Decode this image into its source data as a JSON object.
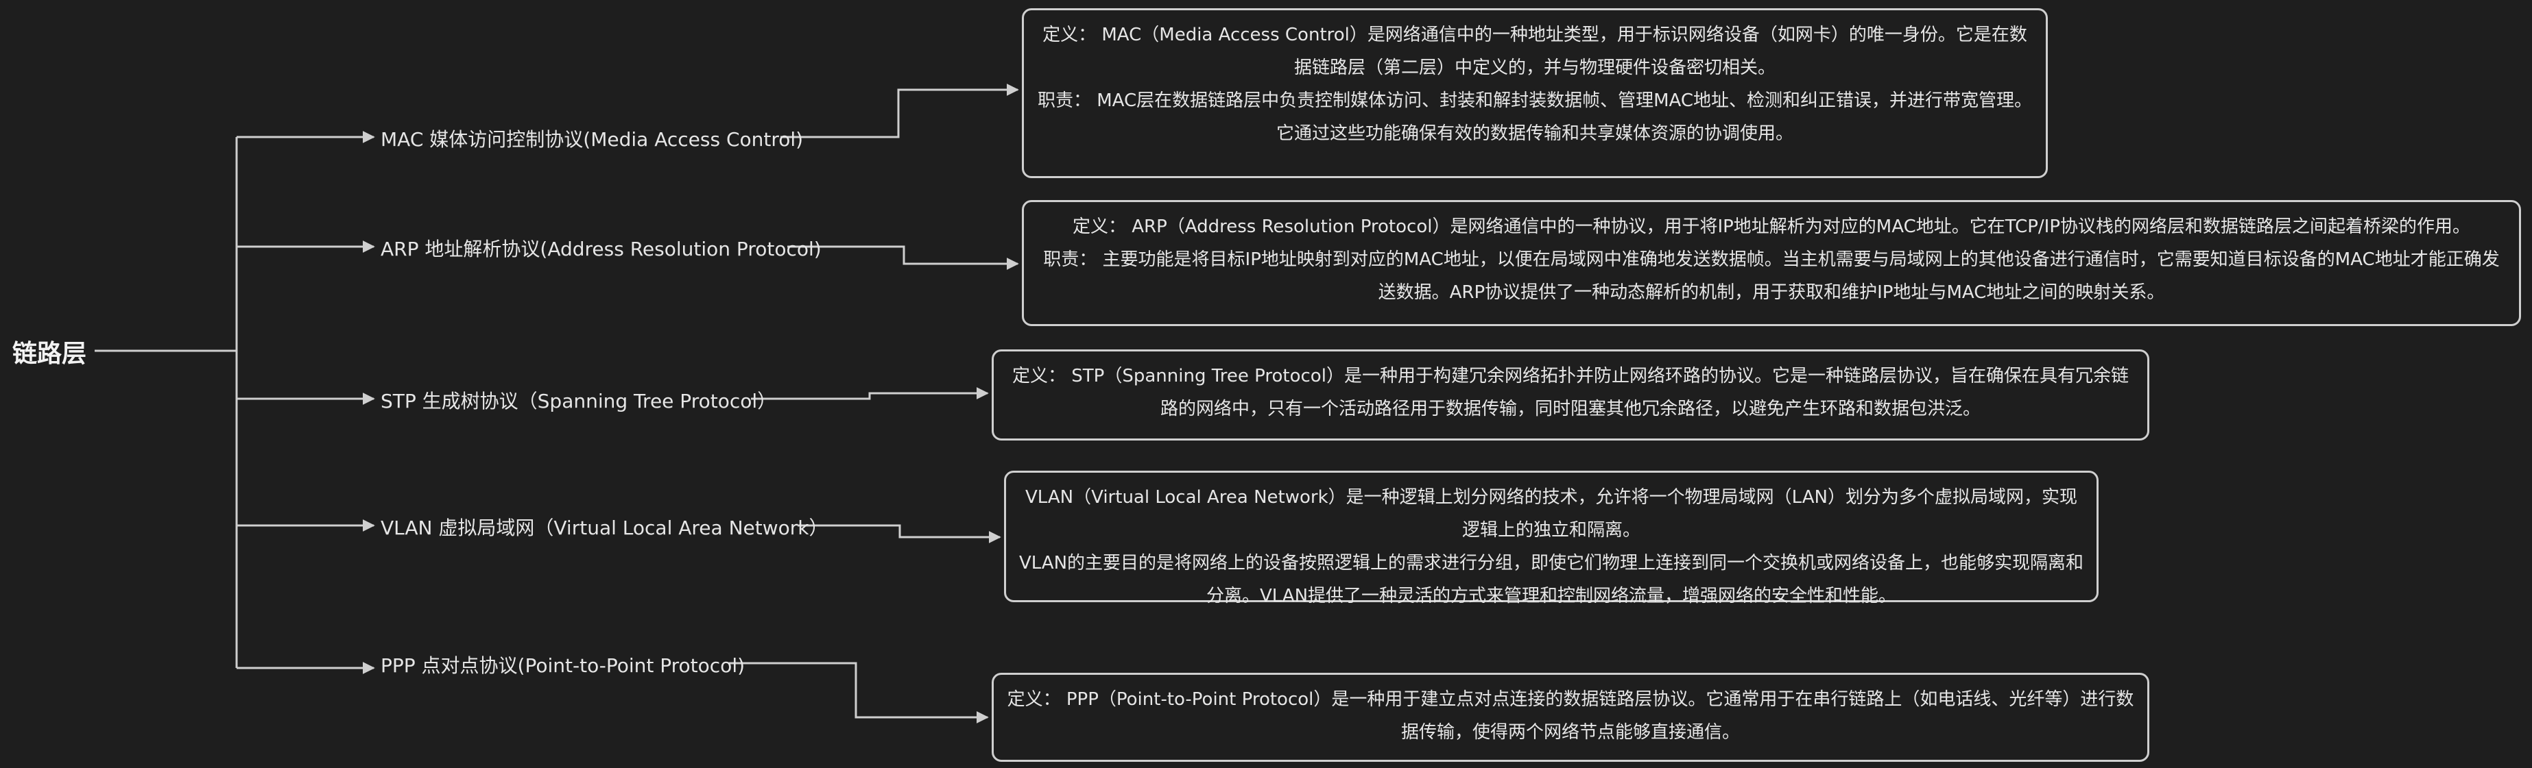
{
  "root": {
    "label": "链路层"
  },
  "branches": [
    {
      "label": "MAC 媒体访问控制协议(Media Access Control)",
      "lines": [
        "定义： MAC（Media Access Control）是网络通信中的一种地址类型，用于标识网络设备（如网卡）的唯一身份。它是在数据链路层（第二层）中定义的，并与物理硬件设备密切相关。",
        "职责： MAC层在数据链路层中负责控制媒体访问、封装和解封装数据帧、管理MAC地址、检测和纠正错误，并进行带宽管理。它通过这些功能确保有效的数据传输和共享媒体资源的协调使用。"
      ]
    },
    {
      "label": "ARP 地址解析协议(Address Resolution Protocol)",
      "lines": [
        "定义： ARP（Address Resolution Protocol）是网络通信中的一种协议，用于将IP地址解析为对应的MAC地址。它在TCP/IP协议栈的网络层和数据链路层之间起着桥梁的作用。",
        "职责： 主要功能是将目标IP地址映射到对应的MAC地址，以便在局域网中准确地发送数据帧。当主机需要与局域网上的其他设备进行通信时，它需要知道目标设备的MAC地址才能正确发送数据。ARP协议提供了一种动态解析的机制，用于获取和维护IP地址与MAC地址之间的映射关系。"
      ]
    },
    {
      "label": "STP 生成树协议（Spanning Tree Protocol）",
      "lines": [
        "定义： STP（Spanning Tree Protocol）是一种用于构建冗余网络拓扑并防止网络环路的协议。它是一种链路层协议，旨在确保在具有冗余链路的网络中，只有一个活动路径用于数据传输，同时阻塞其他冗余路径，以避免产生环路和数据包洪泛。"
      ]
    },
    {
      "label": "VLAN 虚拟局域网（Virtual Local Area Network）",
      "lines": [
        "VLAN（Virtual Local Area Network）是一种逻辑上划分网络的技术，允许将一个物理局域网（LAN）划分为多个虚拟局域网，实现逻辑上的独立和隔离。",
        "VLAN的主要目的是将网络上的设备按照逻辑上的需求进行分组，即使它们物理上连接到同一个交换机或网络设备上，也能够实现隔离和分离。VLAN提供了一种灵活的方式来管理和控制网络流量，增强网络的安全性和性能。"
      ]
    },
    {
      "label": "PPP 点对点协议(Point-to-Point Protocol)",
      "lines": [
        "定义： PPP（Point-to-Point Protocol）是一种用于建立点对点连接的数据链路层协议。它通常用于在串行链路上（如电话线、光纤等）进行数据传输，使得两个网络节点能够直接通信。"
      ]
    }
  ]
}
